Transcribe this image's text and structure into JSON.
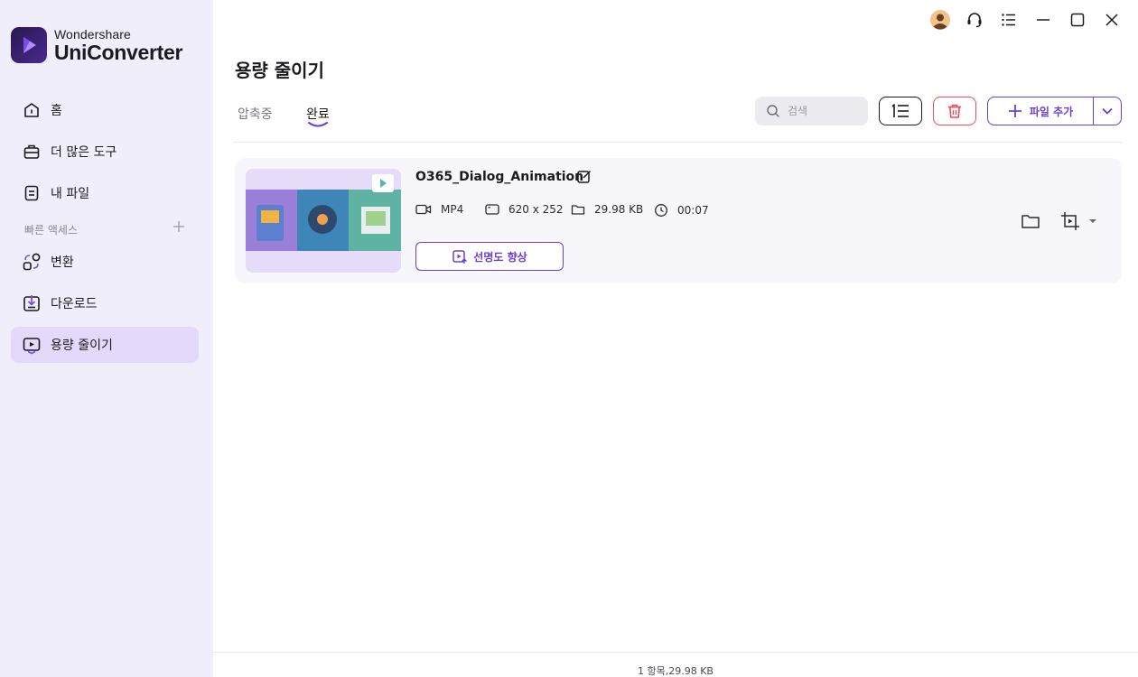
{
  "app": {
    "brand_top": "Wondershare",
    "brand_main": "UniConverter"
  },
  "sidebar": {
    "items": [
      {
        "label": "홈",
        "icon": "home-icon"
      },
      {
        "label": "더 많은 도구",
        "icon": "toolbox-icon"
      },
      {
        "label": "내 파일",
        "icon": "file-icon"
      }
    ],
    "quick_access_label": "빠른 액세스",
    "quick_items": [
      {
        "label": "변환",
        "icon": "convert-icon"
      },
      {
        "label": "다운로드",
        "icon": "download-icon"
      },
      {
        "label": "용량 줄이기",
        "icon": "compress-icon",
        "active": true
      }
    ]
  },
  "page": {
    "title": "용량 줄이기",
    "tabs": [
      {
        "label": "압축중",
        "active": false
      },
      {
        "label": "완료",
        "active": true
      }
    ],
    "search_placeholder": "검색",
    "add_file_label": "파일 추가"
  },
  "files": [
    {
      "name": "O365_Dialog_Animation",
      "format": "MP4",
      "resolution": "620 x 252",
      "size": "29.98 KB",
      "duration": "00:07",
      "enhance_label": "선명도 향상"
    }
  ],
  "footer": {
    "summary": "1 항목,29.98 KB"
  },
  "colors": {
    "accent": "#6b3fd6",
    "sidebar_bg": "#f1eefb",
    "active_nav": "#e5d9fb",
    "danger": "#ef4b5a"
  }
}
